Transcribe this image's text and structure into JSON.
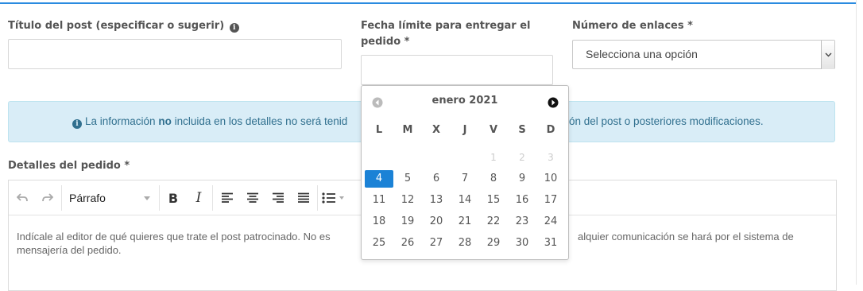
{
  "form": {
    "title_label": "Título del post (especificar o sugerir)",
    "title_info_icon": "info-circle-icon",
    "title_value": "",
    "deadline_label_line1": "Fecha límite para entregar el",
    "deadline_label_line2": "pedido *",
    "deadline_value": "",
    "links_label": "Número de enlaces *",
    "links_selected": "Selecciona una opción"
  },
  "alert": {
    "icon": "info-circle-icon",
    "text_before": "La información",
    "text_bold": "no",
    "text_after": "incluida en los detalles no será tenid",
    "text_tail": "ón del post o posteriores modificaciones.",
    "background": "#d9edf7",
    "text_color": "#31708f"
  },
  "details": {
    "label": "Detalles del pedido *",
    "toolbar": {
      "undo_icon": "undo-icon",
      "redo_icon": "redo-icon",
      "paragraph_label": "Párrafo",
      "bold_label": "B",
      "italic_label": "I",
      "align_icons": [
        "align-left-icon",
        "align-center-icon",
        "align-right-icon",
        "align-justify-icon"
      ],
      "list_icon": "bullet-list-icon"
    },
    "placeholder_part1": "Indícale al editor de qué quieres que trate el post patrocinado. No es",
    "placeholder_part2": "alquier comunicación se hará por el sistema de",
    "placeholder_line2": "mensajería del pedido."
  },
  "datepicker": {
    "month_label": "enero 2021",
    "prev_icon": "prev-month-icon",
    "next_icon": "next-month-icon",
    "weekdays": [
      "L",
      "M",
      "X",
      "J",
      "V",
      "S",
      "D"
    ],
    "weeks": [
      [
        "",
        "",
        "",
        "",
        "1",
        "2",
        "3"
      ],
      [
        "4",
        "5",
        "6",
        "7",
        "8",
        "9",
        "10"
      ],
      [
        "11",
        "12",
        "13",
        "14",
        "15",
        "16",
        "17"
      ],
      [
        "18",
        "19",
        "20",
        "21",
        "22",
        "23",
        "24"
      ],
      [
        "25",
        "26",
        "27",
        "28",
        "29",
        "30",
        "31"
      ]
    ],
    "muted_days": [
      "1",
      "2",
      "3"
    ],
    "selected_day": "4",
    "accent": "#1b82d6"
  }
}
